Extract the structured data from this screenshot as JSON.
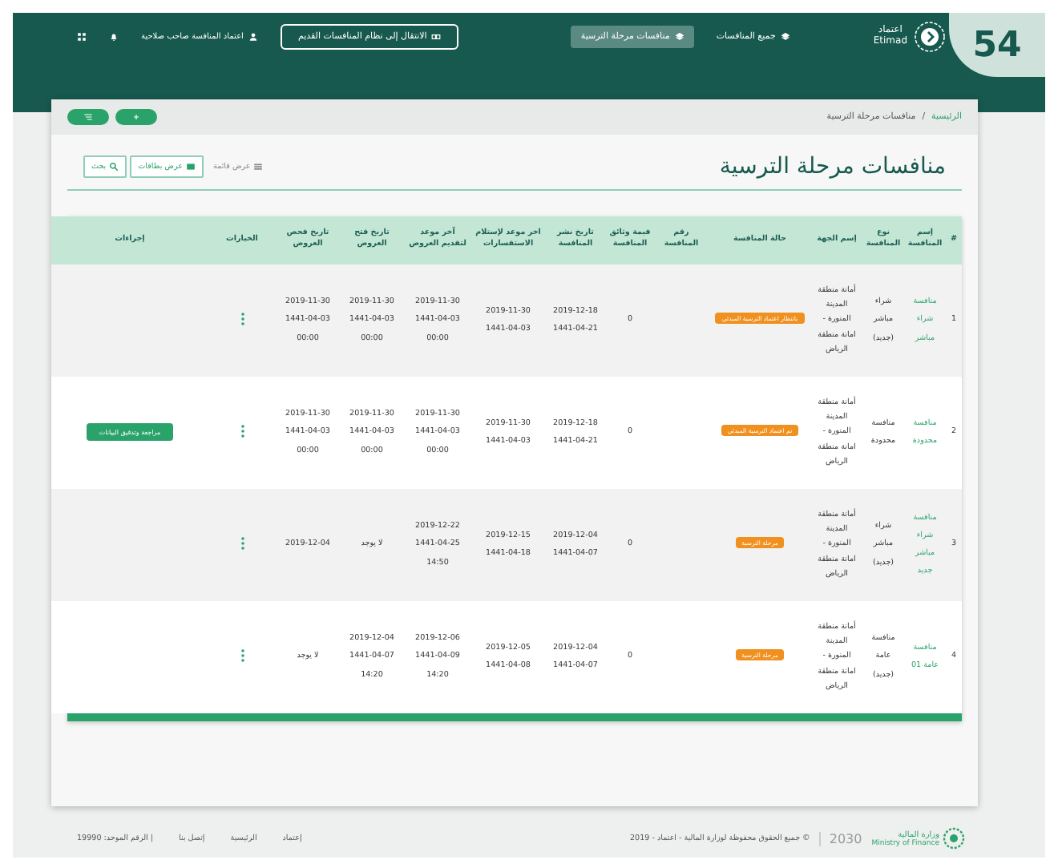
{
  "page_badge": "54",
  "header": {
    "logo": {
      "arabic": "اعتماد",
      "latin": "Etimad"
    },
    "nav": [
      {
        "label": "جميع المنافسات",
        "selected": false
      },
      {
        "label": "منافسات مرحلة الترسية",
        "selected": true
      }
    ],
    "old_system_button": "الانتقال إلى نظام المنافسات القديم",
    "user": "اعتماد المنافسة صاحب صلاحية"
  },
  "breadcrumb_separator": "/",
  "breadcrumb": [
    {
      "label": "الرئيسية",
      "kind": "link"
    },
    {
      "label": "منافسات مرحلة الترسية",
      "kind": "current"
    }
  ],
  "page_title": "منافسات مرحلة الترسية",
  "view_options": [
    {
      "label": "عرض قائمة",
      "kind": "list"
    },
    {
      "label": "عرض بطاقات",
      "kind": "cards"
    },
    {
      "label": "بحث",
      "kind": "search"
    }
  ],
  "table": {
    "columns": [
      "#",
      "إسم المنافسة",
      "نوع المنافسة",
      "إسم الجهة",
      "حالة المنافسة",
      "رقم المنافسة",
      "قيمة وثائق المنافسة",
      "تاريخ نشر المنافسة",
      "اخر موعد لإستلام الاستفسارات",
      "آخر موعد لتقديم العروض",
      "تاريخ فتح العروض",
      "تاريخ فحص العروض",
      "الخيارات",
      "إجراءات"
    ],
    "rows": [
      {
        "index": "1",
        "name": "منافسة شراء مباشر",
        "type": "شراء مباشر (جديد)",
        "entity": "أمانة منطقة المدينة المنورة - امانة منطقة الرياض",
        "status": "بانتظار اعتماد الترسية المبدئي",
        "value": "0",
        "published": "2019-12-18\n1441-04-21",
        "inquiries_deadline": "2019-11-30\n1441-04-03",
        "offers_deadline": "2019-11-30\n1441-04-03\n00:00",
        "opening_date": "2019-11-30\n1441-04-03\n00:00",
        "examination_date": "2019-11-30\n1441-04-03\n00:00"
      },
      {
        "index": "2",
        "name": "منافسة محدودة",
        "type": "منافسة محدودة",
        "entity": "أمانة منطقة المدينة المنورة - امانة منطقة الرياض",
        "status": "تم اعتماد الترسية المبدئي",
        "value": "0",
        "published": "2019-12-18\n1441-04-21",
        "inquiries_deadline": "2019-11-30\n1441-04-03",
        "offers_deadline": "2019-11-30\n1441-04-03\n00:00",
        "opening_date": "2019-11-30\n1441-04-03\n00:00",
        "examination_date": "2019-11-30\n1441-04-03\n00:00",
        "action": "مراجعة وتدقيق البيانات"
      },
      {
        "index": "3",
        "name": "منافسة شراء مباشر جديد",
        "type": "شراء مباشر (جديد)",
        "entity": "أمانة منطقة المدينة المنورة - امانة منطقة الرياض",
        "status": "مرحلة الترسية",
        "value": "0",
        "published": "2019-12-04\n1441-04-07",
        "inquiries_deadline": "2019-12-15\n1441-04-18",
        "offers_deadline": "2019-12-22\n1441-04-25\n14:50",
        "opening_date": "لا يوجد",
        "examination_date": "2019-12-04"
      },
      {
        "index": "4",
        "name": "منافسة عامة 01",
        "type": "منافسة عامة (جديد)",
        "entity": "أمانة منطقة المدينة المنورة - امانة منطقة الرياض",
        "status": "مرحلة الترسية",
        "value": "0",
        "published": "2019-12-04\n1441-04-07",
        "inquiries_deadline": "2019-12-05\n1441-04-08",
        "offers_deadline": "2019-12-06\n1441-04-09\n14:20",
        "opening_date": "2019-12-04\n1441-04-07\n14:20",
        "examination_date": "لا يوجد"
      }
    ]
  },
  "footer": {
    "ministry_logo": {
      "arabic": "وزارة المالية",
      "latin": "Ministry of Finance"
    },
    "vision": "2030",
    "copyright": "© جميع الحقوق محفوظة لوزارة المالية - اعتماد - 2019",
    "links": [
      "إعتماد",
      "الرئيسية",
      "إتصل بنا"
    ],
    "unified_number": "| الرقم الموحد: 19990"
  }
}
